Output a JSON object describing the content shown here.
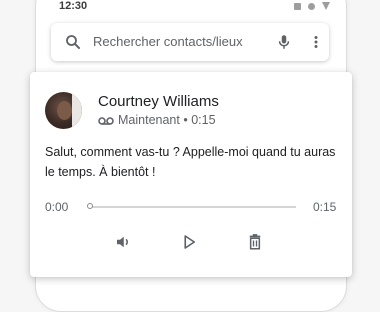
{
  "status_bar": {
    "time": "12:30"
  },
  "search": {
    "placeholder": "Rechercher contacts/lieux"
  },
  "voicemail": {
    "contact_name": "Courtney Williams",
    "timestamp": "Maintenant",
    "separator": "•",
    "duration": "0:15",
    "message": "Salut, comment vas-tu ? Appelle-moi quand tu auras le temps. À bientôt !",
    "player": {
      "current_time": "0:00",
      "total_time": "0:15",
      "progress": 0
    }
  },
  "icons": {
    "search": "search-icon",
    "mic": "mic-icon",
    "more": "more-vert-icon",
    "voicemail": "voicemail-icon",
    "speaker": "speaker-icon",
    "play": "play-icon",
    "delete": "trash-icon"
  },
  "colors": {
    "icon": "#5f6368",
    "text": "#202124",
    "secondary_text": "#5f6368"
  }
}
